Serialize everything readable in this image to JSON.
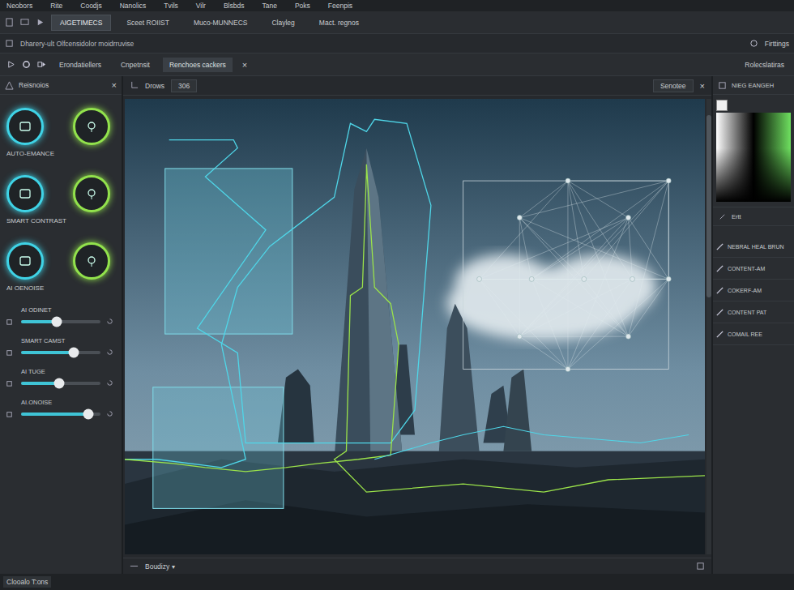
{
  "window": {
    "title": "Neobors"
  },
  "menu": [
    "Neobors",
    "Rite",
    "Coodjs",
    "Nanolics",
    "Tvils",
    "Vilr",
    "Blsbds",
    "Tane",
    "Poks",
    "Feenpis"
  ],
  "toolbar_tabs": [
    {
      "label": "AIGETIMECS",
      "selected": true
    },
    {
      "label": "Sceet ROIIST",
      "selected": false
    },
    {
      "label": "Muco-MUNNECS",
      "selected": false
    },
    {
      "label": "Clayleg",
      "selected": false
    },
    {
      "label": "Mact. regnos",
      "selected": false
    }
  ],
  "info_bar": {
    "text": "Dharery-ult Olfcensidolor moidrruvise",
    "right": "Firttings"
  },
  "sub_tabs": [
    {
      "label": "Erondatiellers",
      "selected": false
    },
    {
      "label": "Cnpetnsit",
      "selected": false
    },
    {
      "label": "Renchoes cackers",
      "selected": true
    }
  ],
  "sub_close": "×",
  "sub_right": "Rolecslatiras",
  "left_panel": {
    "title": "Reisnoios",
    "close": "×",
    "presets": [
      {
        "label": "AUTO-EMANCE"
      },
      {
        "label": "SMART CONTRAST"
      },
      {
        "label": "AI OENOISE"
      }
    ],
    "sliders": [
      {
        "label": "AI ODINET",
        "level": 0.45
      },
      {
        "label": "SMART CAMST",
        "level": 0.66
      },
      {
        "label": "AI TUGE",
        "level": 0.48
      },
      {
        "label": "AI.ONOISE",
        "level": 0.85
      }
    ]
  },
  "canvas": {
    "tab": "Drows",
    "value": "306",
    "right": "Senotee",
    "close": "×",
    "zoom": "Boudizy",
    "zoom_arrow": "▾"
  },
  "right_panel": {
    "title": "NIEG EANGEH",
    "section": "Ertt",
    "tools": [
      "NEBRAL HEAL BRUN",
      "CONTENT-AM",
      "COKERF-AM",
      "CONTENT PAT",
      "COMAIL REE"
    ]
  },
  "status_bar": "Clooalo T:ons"
}
